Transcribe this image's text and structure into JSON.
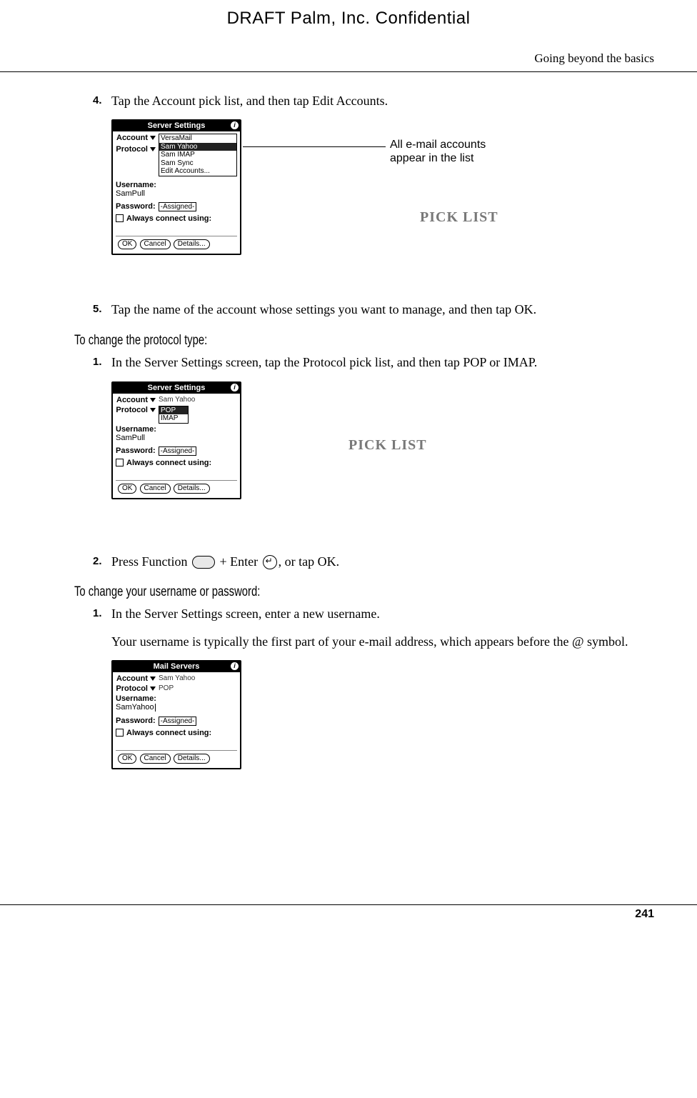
{
  "header": {
    "draft": "DRAFT   Palm, Inc. Confidential",
    "section": "Going beyond the basics"
  },
  "steps": {
    "s4_num": "4.",
    "s4": "Tap the Account pick list, and then tap Edit Accounts.",
    "s5_num": "5.",
    "s5": "Tap the name of the account whose settings you want to manage, and then tap OK.",
    "s2_num": "2.",
    "s2a": "Press Function ",
    "s2b": " + Enter ",
    "s2c": ", or tap OK.",
    "p1_num": "1.",
    "p1": "In the Server Settings screen, tap the Protocol pick list, and then tap POP or IMAP.",
    "u1_num": "1.",
    "u1": "In the Server Settings screen, enter a new username.",
    "u1_para": "Your username is typically the first part of your e-mail address, which appears before the @ symbol."
  },
  "subheads": {
    "protocol": "To change the protocol type:",
    "userpass": "To change your username or password:"
  },
  "callout": {
    "line1": "All e-mail accounts",
    "line2": "appear in the list",
    "picklist": "PICK LIST"
  },
  "palm1": {
    "title": "Server Settings",
    "account_lbl": "Account",
    "protocol_lbl": "Protocol",
    "username_lbl": "Username:",
    "username_val": "SamPull",
    "password_lbl": "Password:",
    "assigned": "-Assigned-",
    "always": "Always connect using:",
    "dd": [
      "VersaMail",
      "Sam Yahoo",
      "Sam IMAP",
      "Sam Sync",
      "Edit Accounts..."
    ],
    "ok": "OK",
    "cancel": "Cancel",
    "details": "Details..."
  },
  "palm2": {
    "title": "Server Settings",
    "account_val": "Sam Yahoo",
    "dd": [
      "POP",
      "IMAP"
    ],
    "username_val": "SamPull"
  },
  "palm3": {
    "title": "Mail Servers",
    "account_val": "Sam Yahoo",
    "protocol_val": "POP",
    "username_val": "SamYahoo"
  },
  "footer": {
    "page": "241"
  }
}
